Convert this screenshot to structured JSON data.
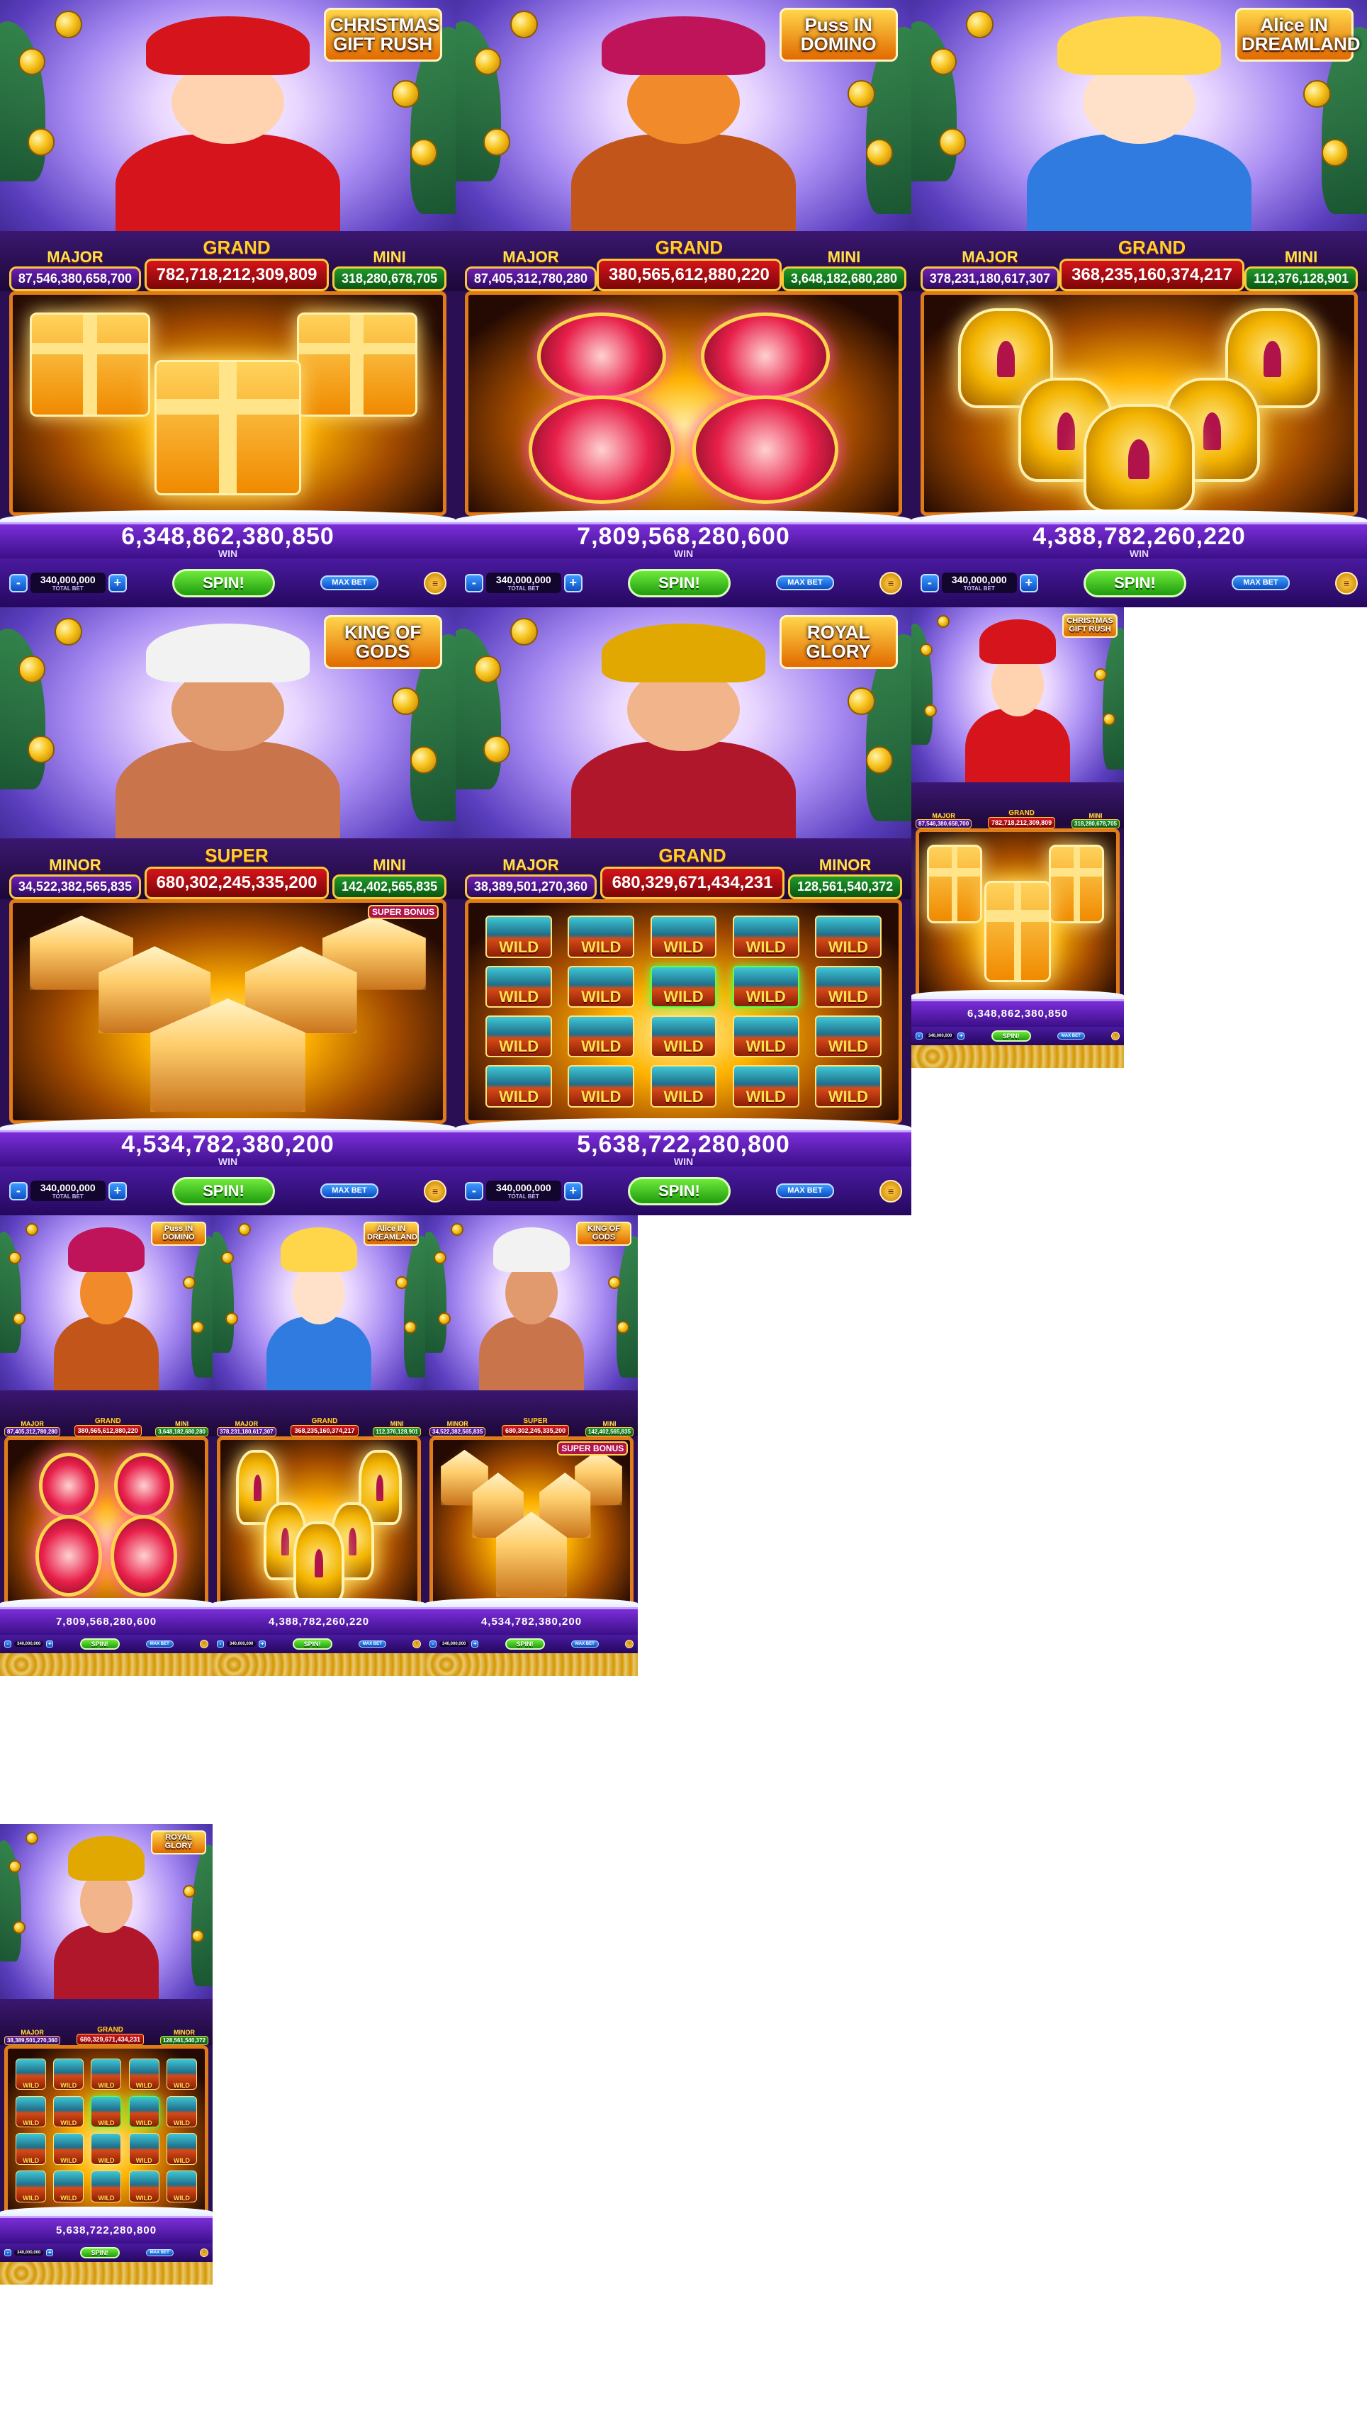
{
  "common": {
    "win_label": "WIN",
    "total_bet_label": "TOTAL BET",
    "bet_value": "340,000,000",
    "minus": "-",
    "plus": "+",
    "spin_label": "SPIN!",
    "max_bet_label": "MAX BET"
  },
  "games": [
    {
      "id": "christmas",
      "logo": "CHRISTMAS GIFT RUSH",
      "jackpots": [
        {
          "name": "MAJOR",
          "value": "87,546,380,658,700"
        },
        {
          "name": "GRAND",
          "value": "782,718,212,309,809"
        },
        {
          "name": "MINI",
          "value": "318,280,678,705"
        }
      ],
      "win": "6,348,862,380,850",
      "colors": {
        "theme": "#d6141c",
        "accent": "#ffd54a"
      }
    },
    {
      "id": "puss",
      "logo": "Puss IN DOMINO",
      "jackpots": [
        {
          "name": "MAJOR",
          "value": "87,405,312,780,280"
        },
        {
          "name": "GRAND",
          "value": "380,565,612,880,220"
        },
        {
          "name": "MINI",
          "value": "3,648,182,680,280"
        }
      ],
      "win": "7,809,568,280,600",
      "colors": {
        "theme": "#e8204a",
        "accent": "#ff4db8"
      }
    },
    {
      "id": "alice",
      "logo": "Alice IN DREAMLAND",
      "jackpots": [
        {
          "name": "MAJOR",
          "value": "378,231,180,617,307"
        },
        {
          "name": "GRAND",
          "value": "368,235,160,374,217"
        },
        {
          "name": "MINI",
          "value": "112,376,128,901"
        }
      ],
      "win": "4,388,782,260,220",
      "colors": {
        "theme": "#2f7be0",
        "accent": "#ffe27a"
      }
    },
    {
      "id": "zeus",
      "logo": "KING OF GODS",
      "jackpots": [
        {
          "name": "MINOR",
          "value": "34,522,382,565,835"
        },
        {
          "name": "SUPER",
          "value": "680,302,245,335,200"
        },
        {
          "name": "MINI",
          "value": "142,402,565,835"
        }
      ],
      "feature_badge": "SUPER BONUS",
      "win": "4,534,782,380,200",
      "colors": {
        "theme": "#c97800",
        "accent": "#9ad8ff"
      }
    },
    {
      "id": "royal",
      "logo": "ROYAL GLORY",
      "jackpots": [
        {
          "name": "MAJOR",
          "value": "38,389,501,270,360"
        },
        {
          "name": "GRAND",
          "value": "680,329,671,434,231"
        },
        {
          "name": "MINOR",
          "value": "128,561,540,372"
        }
      ],
      "wild_label": "WILD",
      "win": "5,638,722,280,800",
      "colors": {
        "theme": "#1f6f8a",
        "accent": "#5cff4a"
      }
    }
  ]
}
